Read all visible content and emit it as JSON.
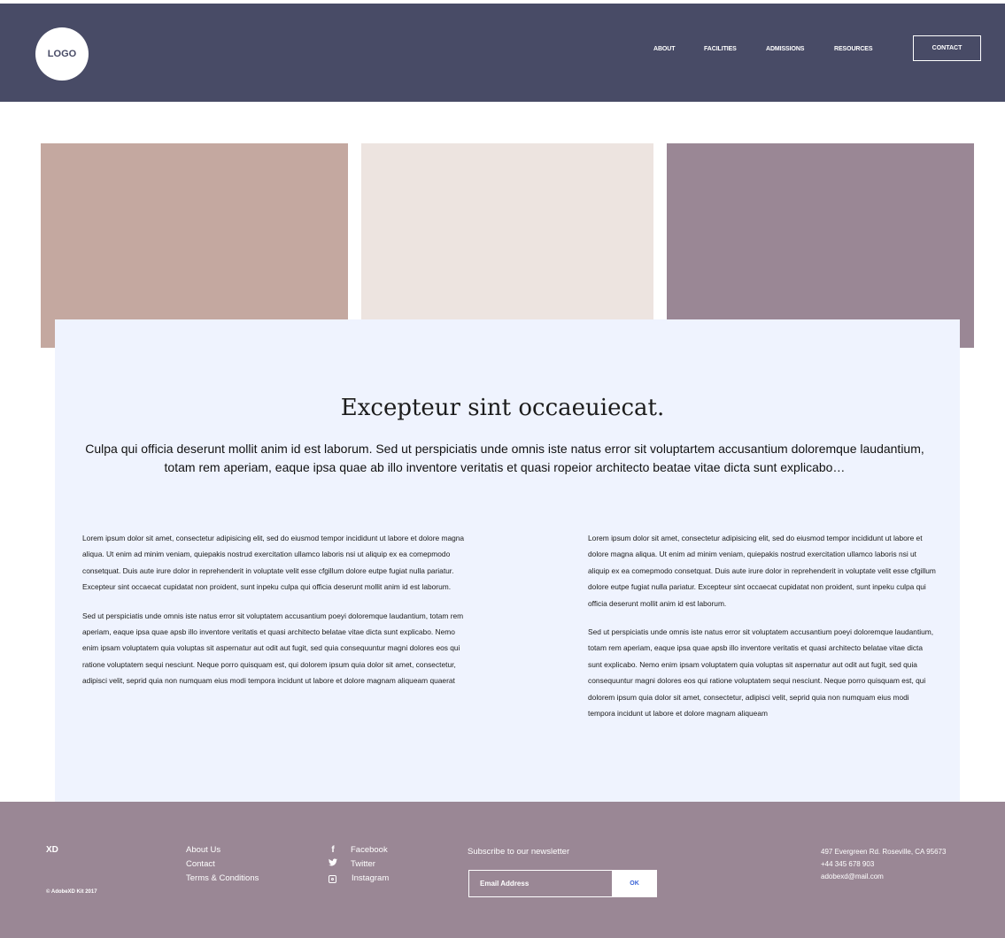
{
  "header": {
    "logo": "LOGO",
    "nav": [
      "ABOUT",
      "FACILITIES",
      "ADMISSIONS",
      "RESOURCES"
    ],
    "contact_button": "CONTACT",
    "background": "#484b66"
  },
  "images": [
    {
      "color": "#c4a8a0"
    },
    {
      "color": "#ede4e0"
    },
    {
      "color": "#9a8795"
    }
  ],
  "content": {
    "headline": "Excepteur sint occaeuiecat.",
    "intro": "Culpa qui officia deserunt mollit anim id est laborum. Sed ut perspiciatis unde omnis iste natus error sit voluptartem accusantium doloremque laudantium, totam rem aperiam, eaque ipsa quae ab illo inventore veritatis et quasi ropeior architecto beatae vitae dicta sunt explicabo…",
    "left_column": {
      "p1": "Lorem ipsum dolor sit amet, consectetur adipisicing elit, sed do eiusmod tempor incididunt ut labore et dolore magna aliqua. Ut enim ad minim veniam, quiepakis nostrud exercitation ullamco laboris nsi ut aliquip ex ea comepmodo consetquat. Duis aute irure dolor in reprehenderit in voluptate velit esse cfgillum dolore eutpe fugiat nulla pariatur. Excepteur sint occaecat cupidatat non proident, sunt inpeku culpa qui officia deserunt mollit anim id est laborum.",
      "p2": "Sed ut perspiciatis unde omnis iste natus error sit voluptatem accusantium poeyi doloremque laudantium, totam rem aperiam, eaque ipsa quae apsb illo inventore veritatis et quasi architecto belatae vitae dicta sunt explicabo. Nemo enim ipsam voluptatem quia voluptas sit aspernatur aut odit aut fugit, sed quia consequuntur magni dolores eos qui ratione voluptatem sequi nesciunt. Neque porro quisquam est, qui dolorem ipsum quia dolor sit amet, consectetur, adipisci velit, seprid quia non numquam eius modi tempora incidunt ut labore et dolore magnam aliqueam quaerat"
    },
    "right_column": {
      "p1": "Lorem ipsum dolor sit amet, consectetur adipisicing elit, sed do eiusmod tempor incididunt ut labore et dolore magna aliqua. Ut enim ad minim veniam, quiepakis nostrud exercitation ullamco laboris nsi ut aliquip ex ea comepmodo consetquat. Duis aute irure dolor in reprehenderit in voluptate velit esse cfgillum dolore eutpe fugiat nulla pariatur. Excepteur sint occaecat cupidatat non proident, sunt inpeku culpa qui officia deserunt mollit anim id est laborum.",
      "p2": "Sed ut perspiciatis unde omnis iste natus error sit voluptatem accusantium poeyi doloremque laudantium, totam rem aperiam, eaque ipsa quae apsb illo inventore veritatis et quasi architecto belatae vitae dicta sunt explicabo. Nemo enim ipsam voluptatem quia voluptas sit aspernatur aut odit aut fugit, sed quia consequuntur magni dolores eos qui ratione voluptatem sequi nesciunt. Neque porro quisquam est, qui dolorem ipsum quia dolor sit amet, consectetur, adipisci velit, seprid quia non numquam eius modi tempora incidunt ut labore et dolore magnam aliqueam"
    }
  },
  "footer": {
    "brand": "XD",
    "copyright": "© AdobeXD Kit 2017",
    "links": [
      "About Us",
      "Contact",
      "Terms & Conditions"
    ],
    "social": [
      {
        "icon": "facebook-icon",
        "glyph": "f",
        "label": "Facebook"
      },
      {
        "icon": "twitter-icon",
        "glyph": "🐦",
        "label": "Twitter"
      },
      {
        "icon": "instagram-icon",
        "glyph": "",
        "label": "Instagram"
      }
    ],
    "newsletter_title": "Subscribe to our newsletter",
    "email_placeholder": "Email Address",
    "ok_button": "OK",
    "address": "497 Evergreen Rd. Roseville, CA 95673",
    "phone": "+44 345 678 903",
    "email": "adobexd@mail.com",
    "background": "#9a8795"
  }
}
